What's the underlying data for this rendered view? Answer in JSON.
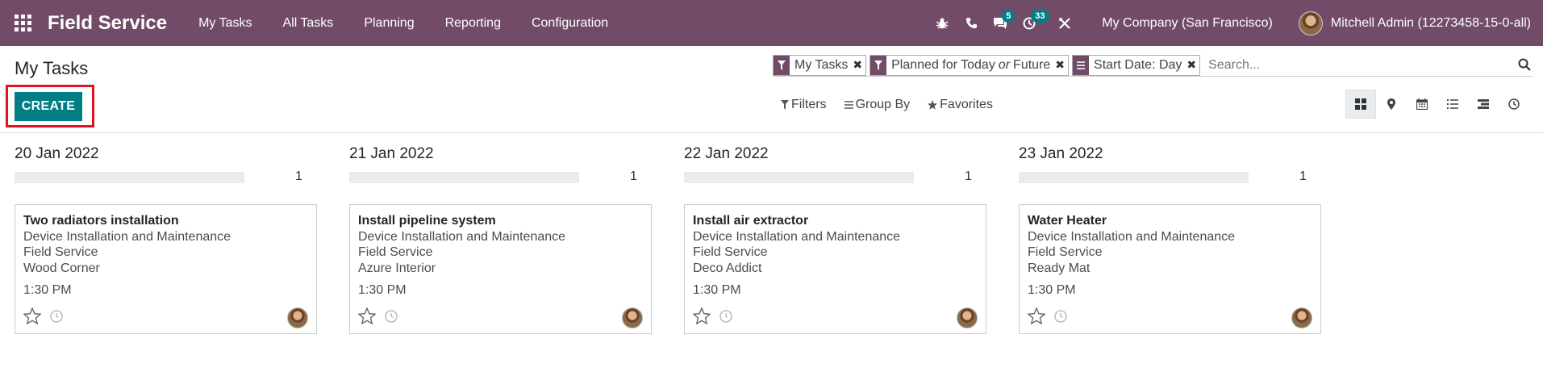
{
  "navbar": {
    "app_name": "Field Service",
    "menu": [
      "My Tasks",
      "All Tasks",
      "Planning",
      "Reporting",
      "Configuration"
    ],
    "messages_badge": "5",
    "activities_badge": "33",
    "company": "My Company (San Francisco)",
    "user": "Mitchell Admin (12273458-15-0-all)",
    "icons": [
      "apps-grid-icon",
      "bug-icon",
      "phone-icon",
      "chat-icon",
      "clock-icon",
      "close-icon"
    ],
    "colors": {
      "bar": "#714b67",
      "badge": "#017e84"
    }
  },
  "control_panel": {
    "title": "My Tasks",
    "create_label": "CREATE",
    "search": {
      "facets": [
        {
          "icon": "filter-icon",
          "label": "My Tasks"
        },
        {
          "icon": "filter-icon",
          "label_parts": [
            "Planned for Today",
            "or",
            "Future"
          ]
        },
        {
          "icon": "group-by-icon",
          "label": "Start Date: Day"
        }
      ],
      "placeholder": "Search..."
    },
    "filters_label": "Filters",
    "group_by_label": "Group By",
    "favorites_label": "Favorites",
    "views": [
      "kanban",
      "map",
      "calendar",
      "list",
      "gantt",
      "activity"
    ],
    "active_view": "kanban"
  },
  "kanban": {
    "columns": [
      {
        "title": "20 Jan 2022",
        "count": "1",
        "card": {
          "title": "Two radiators installation",
          "project": "Device Installation and Maintenance",
          "service": "Field Service",
          "customer": "Wood Corner",
          "time": "1:30 PM"
        }
      },
      {
        "title": "21 Jan 2022",
        "count": "1",
        "card": {
          "title": "Install pipeline system",
          "project": "Device Installation and Maintenance",
          "service": "Field Service",
          "customer": "Azure Interior",
          "time": "1:30 PM"
        }
      },
      {
        "title": "22 Jan 2022",
        "count": "1",
        "card": {
          "title": "Install air extractor",
          "project": "Device Installation and Maintenance",
          "service": "Field Service",
          "customer": "Deco Addict",
          "time": "1:30 PM"
        }
      },
      {
        "title": "23 Jan 2022",
        "count": "1",
        "card": {
          "title": "Water Heater",
          "project": "Device Installation and Maintenance",
          "service": "Field Service",
          "customer": "Ready Mat",
          "time": "1:30 PM"
        }
      }
    ]
  }
}
